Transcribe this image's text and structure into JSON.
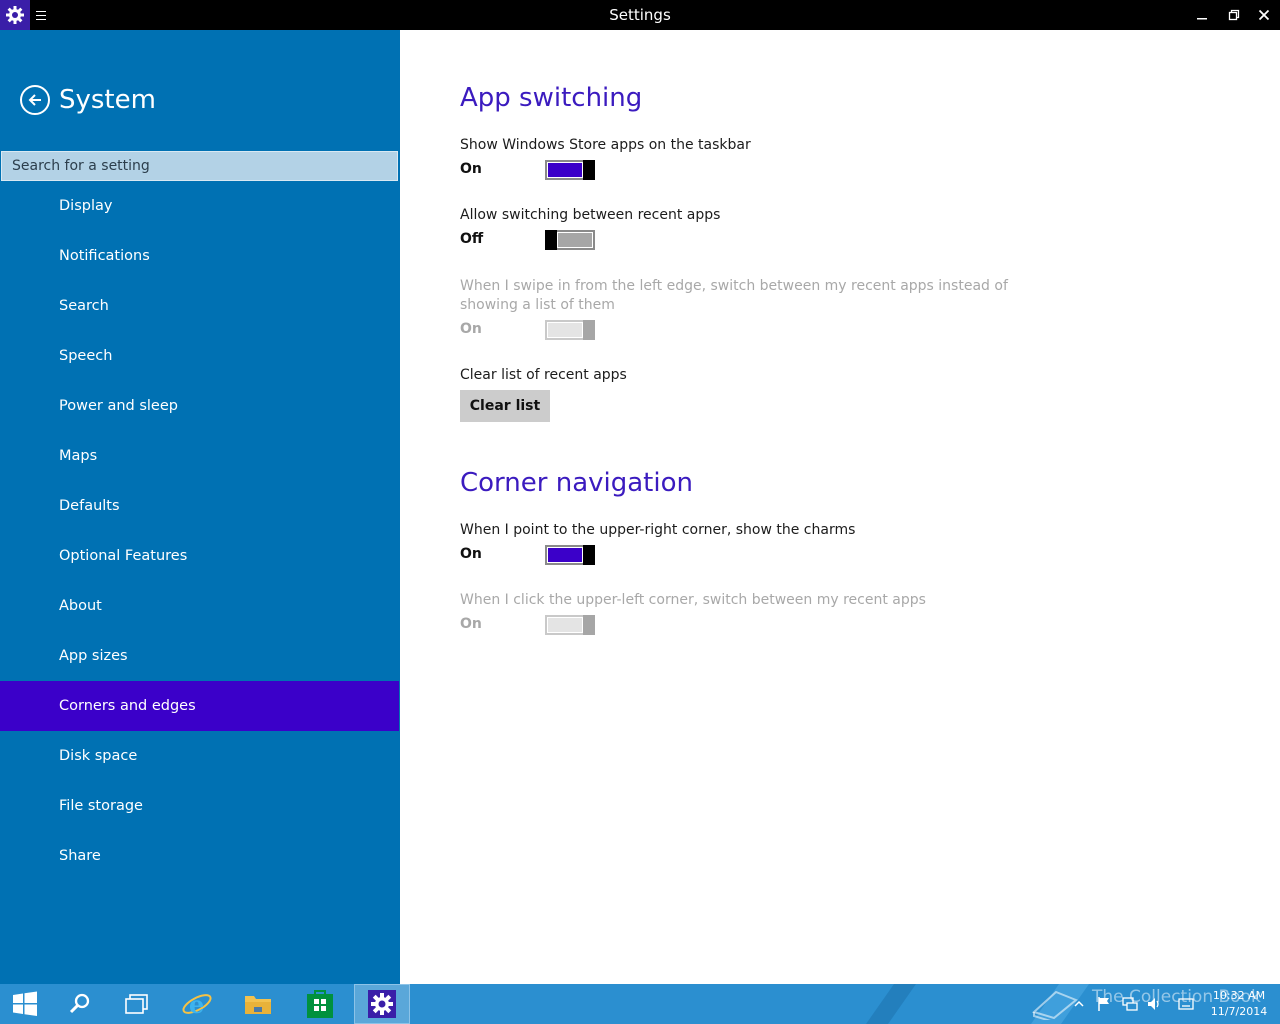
{
  "window": {
    "title": "Settings",
    "app_icon": "gear-icon",
    "menu_icon": "hamburger-icon",
    "controls": [
      "minimize-icon",
      "restore-icon",
      "close-icon"
    ]
  },
  "sidebar": {
    "back_icon": "back-arrow-icon",
    "title": "System",
    "search_placeholder": "Search for a setting",
    "items": [
      {
        "label": "Display"
      },
      {
        "label": "Notifications"
      },
      {
        "label": "Search"
      },
      {
        "label": "Speech"
      },
      {
        "label": "Power and sleep"
      },
      {
        "label": "Maps"
      },
      {
        "label": "Defaults"
      },
      {
        "label": "Optional Features"
      },
      {
        "label": "About"
      },
      {
        "label": "App sizes"
      },
      {
        "label": "Corners and edges",
        "selected": true
      },
      {
        "label": "Disk space"
      },
      {
        "label": "File storage"
      },
      {
        "label": "Share"
      }
    ]
  },
  "main": {
    "app_switching": {
      "title": "App switching",
      "store_apps": {
        "label": "Show Windows Store apps on the taskbar",
        "state": "On",
        "value": true
      },
      "recent_apps": {
        "label": "Allow switching between recent apps",
        "state": "Off",
        "value": false
      },
      "swipe_left": {
        "label": "When I swipe in from the left edge, switch between my recent apps instead of showing a list of them",
        "state": "On",
        "value": true,
        "disabled": true
      },
      "clear": {
        "label": "Clear list of recent apps",
        "button": "Clear list"
      }
    },
    "corner_navigation": {
      "title": "Corner navigation",
      "charms": {
        "label": "When I point to the upper-right corner, show the charms",
        "state": "On",
        "value": true
      },
      "upper_left": {
        "label": "When I click the upper-left corner, switch between my recent apps",
        "state": "On",
        "value": true,
        "disabled": true
      }
    }
  },
  "taskbar": {
    "buttons": [
      "windows-start-icon",
      "search-icon",
      "task-view-icon",
      "internet-explorer-icon",
      "file-explorer-icon",
      "store-icon",
      "settings-icon"
    ],
    "tray_icons": [
      "show-hidden-icons-icon",
      "action-center-flag-icon",
      "network-icon",
      "volume-icon",
      "keyboard-icon"
    ],
    "watermark": "The Collection Book",
    "time": "10:32 AM",
    "date": "11/7/2014"
  },
  "colors": {
    "sidebar_bg": "#0071b3",
    "accent": "#3b00c9",
    "section_title": "#3b1bbf",
    "taskbar_bg": "#2b8fd0",
    "titlebar_bg": "#000000"
  }
}
